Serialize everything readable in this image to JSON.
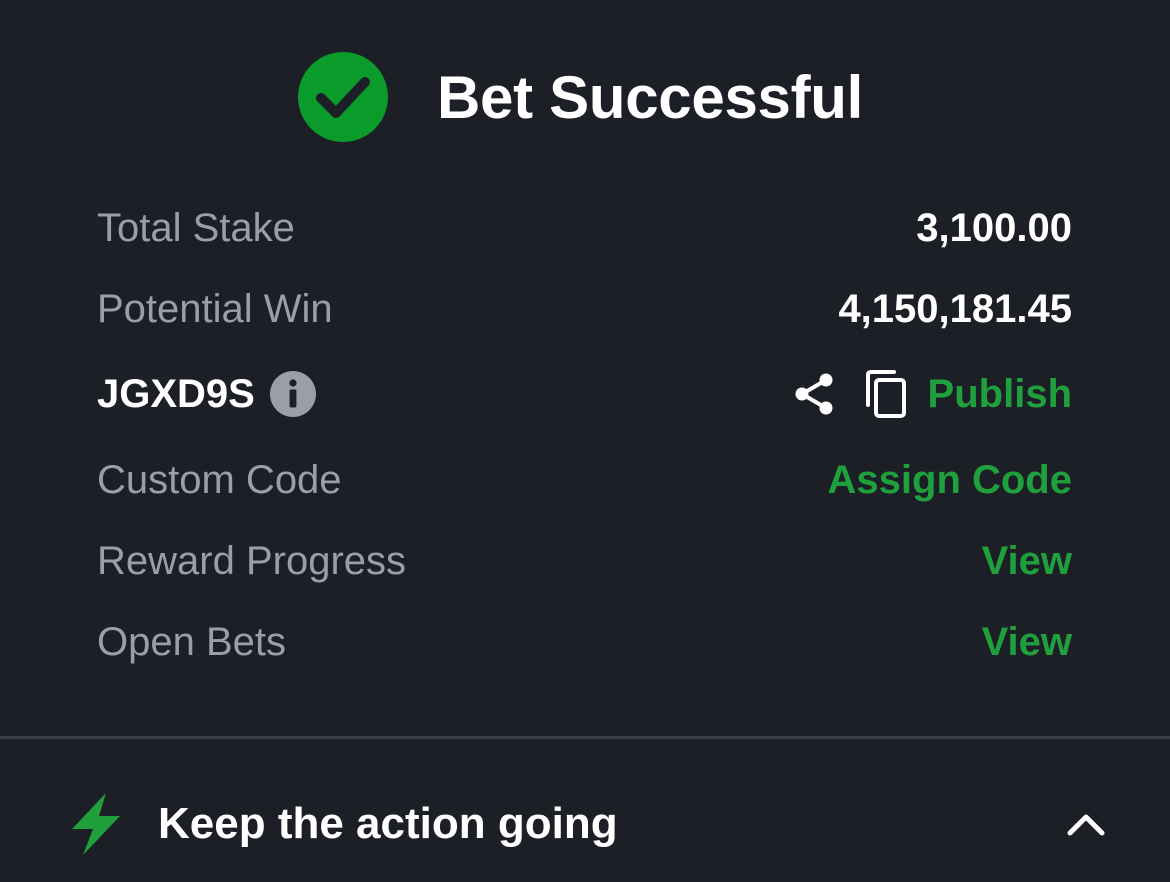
{
  "header": {
    "title": "Bet Successful",
    "icon": "check-circle-icon"
  },
  "details": {
    "total_stake_label": "Total Stake",
    "total_stake_value": "3,100.00",
    "potential_win_label": "Potential Win",
    "potential_win_value": "4,150,181.45",
    "booking_code": "JGXD9S",
    "publish_label": "Publish",
    "custom_code_label": "Custom Code",
    "assign_code_label": "Assign Code",
    "reward_progress_label": "Reward Progress",
    "reward_view_label": "View",
    "open_bets_label": "Open Bets",
    "open_bets_view_label": "View"
  },
  "footer": {
    "title": "Keep the action going",
    "icon": "lightning-bolt-icon",
    "toggle_icon": "chevron-up-icon"
  },
  "colors": {
    "background": "#1c1f26",
    "accent_green": "#1fa03d",
    "success_green": "#0a9b2b",
    "label_gray": "#9a9ea8",
    "divider": "#3a3e49"
  }
}
